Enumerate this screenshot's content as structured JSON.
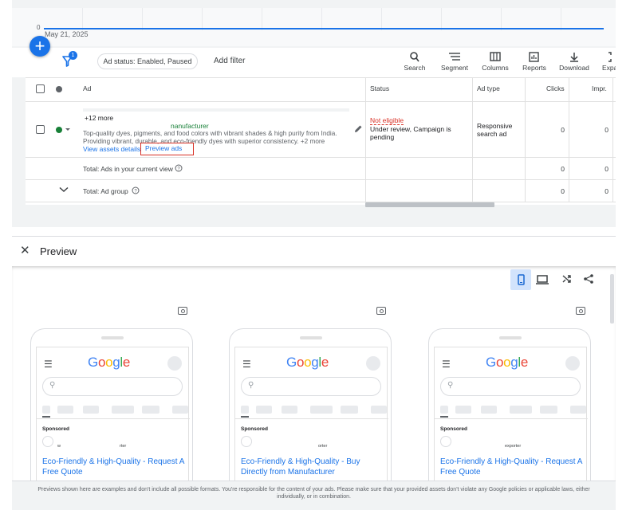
{
  "chart": {
    "zero_tick": "0",
    "date_label": "May 21, 2025"
  },
  "toolbar": {
    "add_label": "+",
    "filter_badge": "1",
    "status_chip": "Ad status: Enabled, Paused",
    "add_filter": "Add filter",
    "tools": [
      {
        "icon": "search-icon",
        "glyph": "⚲",
        "label": "Search"
      },
      {
        "icon": "segment-icon",
        "glyph": "☰",
        "label": "Segment"
      },
      {
        "icon": "columns-icon",
        "glyph": "▥",
        "label": "Columns"
      },
      {
        "icon": "reports-icon",
        "glyph": "▤",
        "label": "Reports"
      },
      {
        "icon": "download-icon",
        "glyph": "⤓",
        "label": "Download"
      },
      {
        "icon": "expand-icon",
        "glyph": "⛶",
        "label": "Expa"
      }
    ]
  },
  "table": {
    "headers": {
      "ad": "Ad",
      "status": "Status",
      "ad_type": "Ad type",
      "clicks": "Clicks",
      "impr": "Impr."
    },
    "row": {
      "more": "+12 more",
      "manufacturer": "nanufacturer",
      "description": "Top-quality dyes, pigments, and food colors with vibrant shades & high purity from India. Providing vibrant, durable, and eco-friendly dyes with superior consistency.  +2 more",
      "view_assets": "View assets details",
      "preview_ads": "Preview ads",
      "status_main": "Not eligible",
      "status_detail": "Under review, Campaign is pending",
      "ad_type": "Responsive search ad",
      "clicks": "0",
      "impr": "0"
    },
    "total_view": {
      "label": "Total: Ads in your current view",
      "clicks": "0",
      "impr": "0"
    },
    "total_group": {
      "label": "Total: Ad group",
      "clicks": "0",
      "impr": "0"
    }
  },
  "preview": {
    "close_glyph": "✕",
    "title": "Preview",
    "mobile_glyph": "▯",
    "desktop_glyph": "▭",
    "shuffle_glyph": "⤨",
    "share_glyph": "<",
    "phones": [
      {
        "logo": "Google",
        "sponsored": "Sponsored",
        "domain_left": "w",
        "domain_right": "rter",
        "headline": "Eco-Friendly & High-Quality - Request A Free Quote"
      },
      {
        "logo": "Google",
        "sponsored": "Sponsored",
        "domain_left": "",
        "domain_right": "orter",
        "headline": "Eco-Friendly & High-Quality - Buy Directly from Manufacturer"
      },
      {
        "logo": "Google",
        "sponsored": "Sponsored",
        "domain_left": "",
        "domain_right": "exporter",
        "headline": "Eco-Friendly & High-Quality - Request A Free Quote"
      }
    ],
    "disclaimer": "Previews shown here are examples and don't include all possible formats. You're responsible for the content of your ads. Please make sure that your provided assets don't violate any Google policies or applicable laws, either individually, or in combination."
  },
  "colors": {
    "accent": "#1a73e8",
    "error": "#d93025",
    "enabled": "#188038"
  }
}
